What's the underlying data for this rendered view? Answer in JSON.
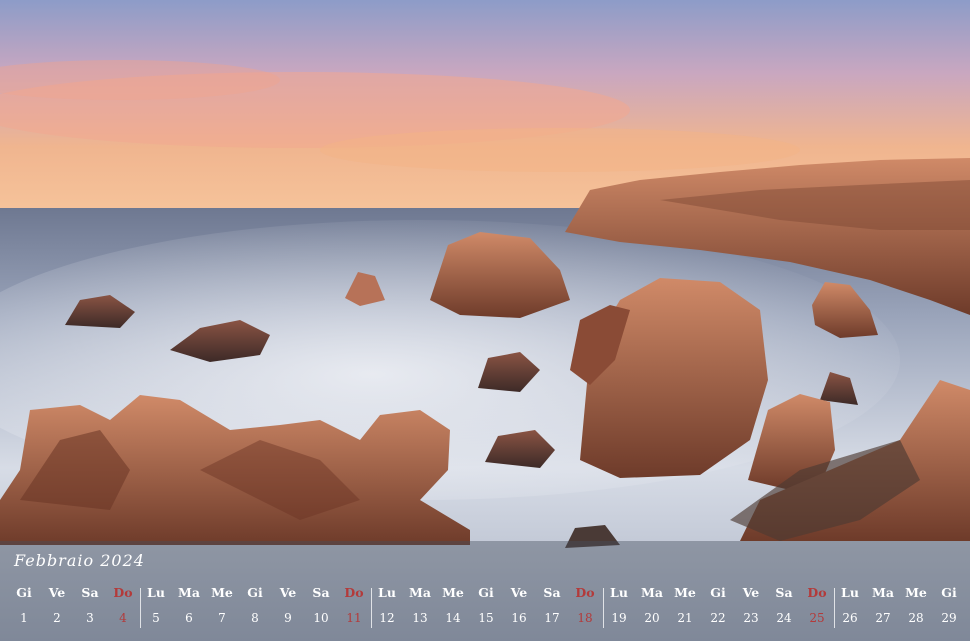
{
  "calendar": {
    "month_label": "Febbraio 2024",
    "sunday_color": "#b33a3a",
    "days": [
      {
        "wd": "Gi",
        "n": "1"
      },
      {
        "wd": "Ve",
        "n": "2"
      },
      {
        "wd": "Sa",
        "n": "3"
      },
      {
        "wd": "Do",
        "n": "4",
        "sunday": true
      },
      {
        "wd": "Lu",
        "n": "5"
      },
      {
        "wd": "Ma",
        "n": "6"
      },
      {
        "wd": "Me",
        "n": "7"
      },
      {
        "wd": "Gi",
        "n": "8"
      },
      {
        "wd": "Ve",
        "n": "9"
      },
      {
        "wd": "Sa",
        "n": "10"
      },
      {
        "wd": "Do",
        "n": "11",
        "sunday": true
      },
      {
        "wd": "Lu",
        "n": "12"
      },
      {
        "wd": "Ma",
        "n": "13"
      },
      {
        "wd": "Me",
        "n": "14"
      },
      {
        "wd": "Gi",
        "n": "15"
      },
      {
        "wd": "Ve",
        "n": "16"
      },
      {
        "wd": "Sa",
        "n": "17"
      },
      {
        "wd": "Do",
        "n": "18",
        "sunday": true
      },
      {
        "wd": "Lu",
        "n": "19"
      },
      {
        "wd": "Ma",
        "n": "20"
      },
      {
        "wd": "Me",
        "n": "21"
      },
      {
        "wd": "Gi",
        "n": "22"
      },
      {
        "wd": "Ve",
        "n": "23"
      },
      {
        "wd": "Sa",
        "n": "24"
      },
      {
        "wd": "Do",
        "n": "25",
        "sunday": true
      },
      {
        "wd": "Lu",
        "n": "26"
      },
      {
        "wd": "Ma",
        "n": "27"
      },
      {
        "wd": "Me",
        "n": "28"
      },
      {
        "wd": "Gi",
        "n": "29"
      }
    ]
  }
}
